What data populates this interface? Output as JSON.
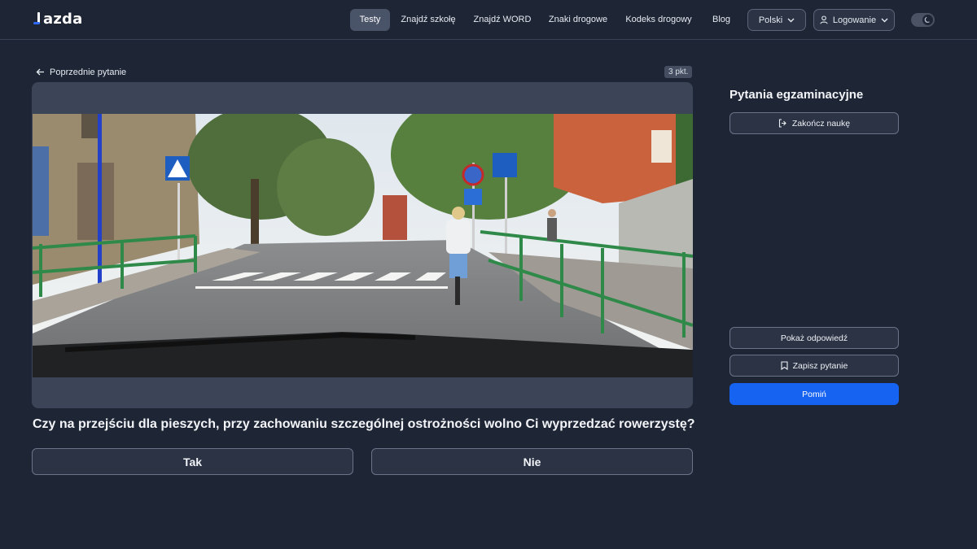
{
  "app": {
    "logo_text": "azda",
    "brand_color": "#2f6bff"
  },
  "nav": {
    "items": [
      {
        "label": "Testy",
        "active": true
      },
      {
        "label": "Znajdź szkołę",
        "active": false
      },
      {
        "label": "Znajdź WORD",
        "active": false
      },
      {
        "label": "Znaki drogowe",
        "active": false
      },
      {
        "label": "Kodeks drogowy",
        "active": false
      },
      {
        "label": "Blog",
        "active": false
      }
    ],
    "language_label": "Polski",
    "login_label": "Logowanie",
    "theme_toggle_icon": "moon-icon"
  },
  "question_panel": {
    "prev_label": "Poprzednie pytanie",
    "points": "3 pkt.",
    "image_description_icon": "exam-photo",
    "question_text": "Czy na przejściu dla pieszych, przy zachowaniu szczególnej ostrożności wolno Ci wyprzedzać rowerzystę?",
    "answers": [
      "Tak",
      "Nie"
    ]
  },
  "sidebar": {
    "title": "Pytania egzaminacyjne",
    "end_label": "Zakończ naukę",
    "show_answer_label": "Pokaż odpowiedź",
    "save_label": "Zapisz pytanie",
    "skip_label": "Pomiń",
    "primary_color": "#1663f2"
  }
}
